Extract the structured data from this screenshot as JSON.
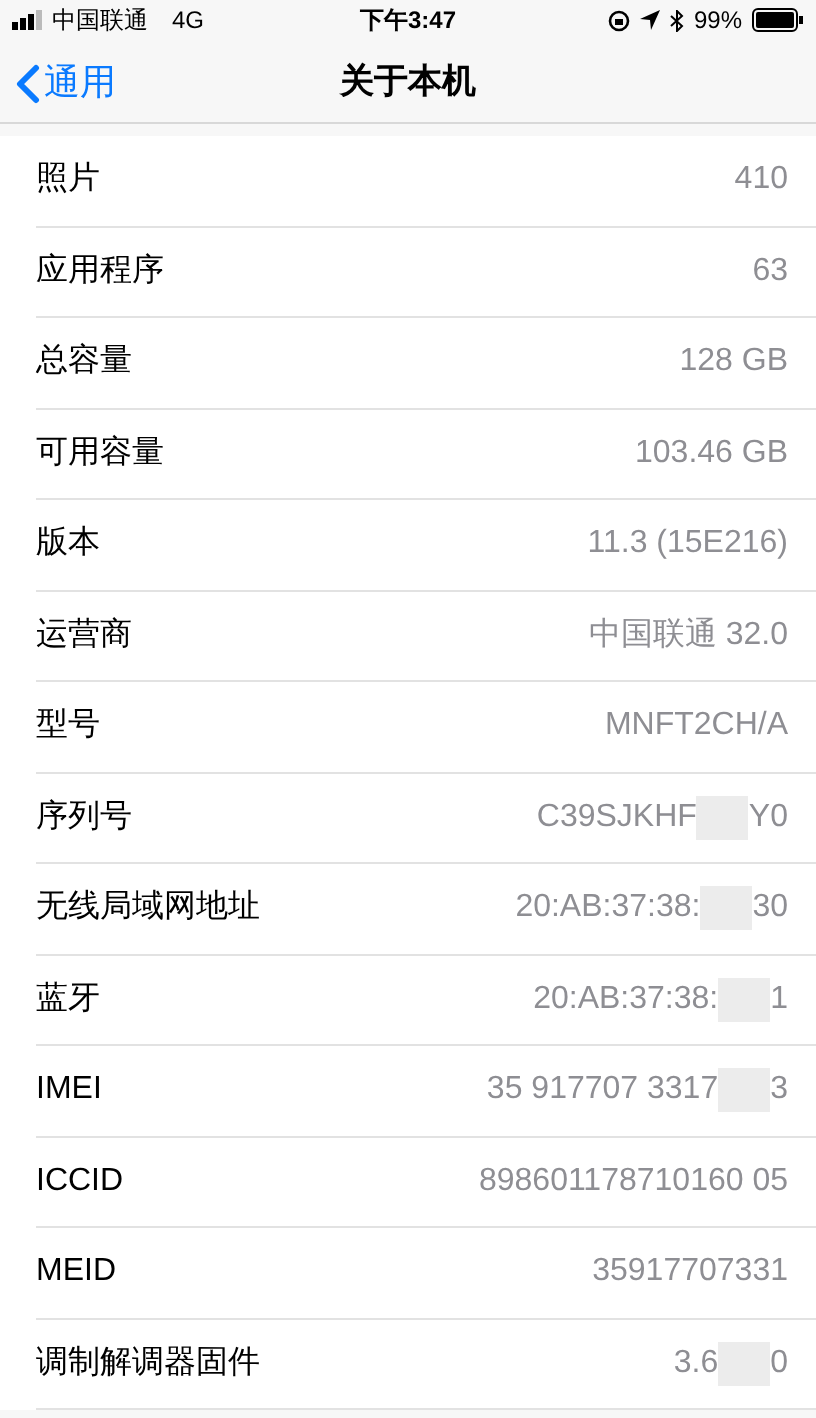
{
  "status_bar": {
    "carrier": "中国联通",
    "network": "4G",
    "time": "下午3:47",
    "battery": "99%"
  },
  "nav": {
    "back": "通用",
    "title": "关于本机"
  },
  "rows": [
    {
      "label": "照片",
      "value": "410"
    },
    {
      "label": "应用程序",
      "value": "63"
    },
    {
      "label": "总容量",
      "value": "128 GB"
    },
    {
      "label": "可用容量",
      "value": "103.46 GB"
    },
    {
      "label": "版本",
      "value": "11.3 (15E216)"
    },
    {
      "label": "运营商",
      "value": "中国联通 32.0"
    },
    {
      "label": "型号",
      "value": "MNFT2CH/A"
    },
    {
      "label": "序列号",
      "value": "C39SJKHF",
      "tail": "Y0"
    },
    {
      "label": "无线局域网地址",
      "value": "20:AB:37:38:",
      "tail": "30"
    },
    {
      "label": "蓝牙",
      "value": "20:AB:37:38:",
      "tail": "1"
    },
    {
      "label": "IMEI",
      "value": "35 917707 3317",
      "tail": "3"
    },
    {
      "label": "ICCID",
      "value": "898601178710160 05"
    },
    {
      "label": "MEID",
      "value": "35917707331"
    },
    {
      "label": "调制解调器固件",
      "value": "3.6",
      "tail": "0"
    }
  ]
}
